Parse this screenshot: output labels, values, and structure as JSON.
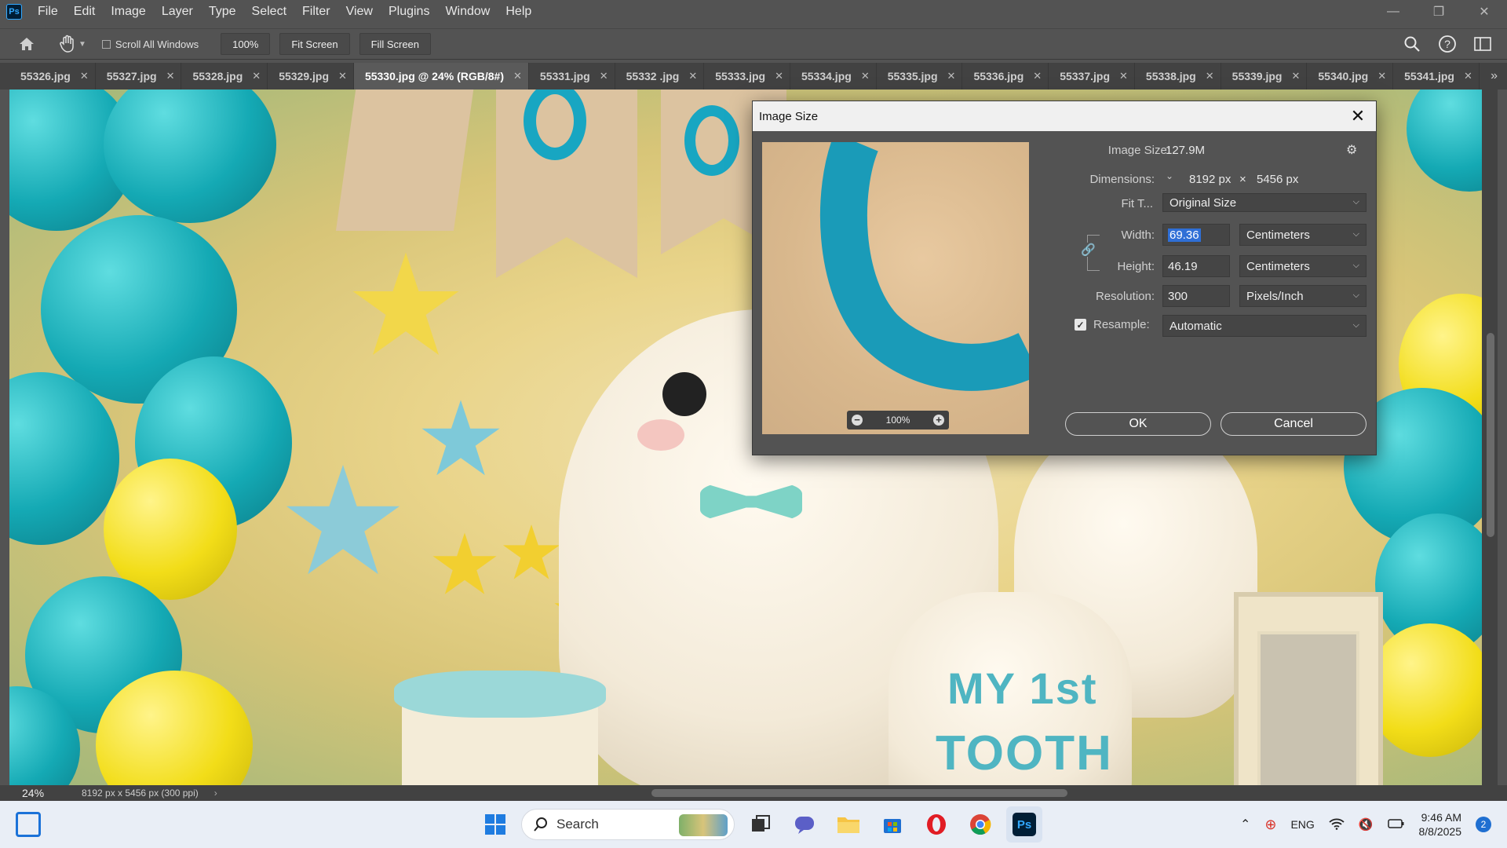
{
  "menu": [
    "File",
    "Edit",
    "Image",
    "Layer",
    "Type",
    "Select",
    "Filter",
    "View",
    "Plugins",
    "Window",
    "Help"
  ],
  "app_logo": "Ps",
  "options": {
    "scroll_all_windows": "Scroll All Windows",
    "zoom_value": "100%",
    "fit_screen": "Fit Screen",
    "fill_screen": "Fill Screen"
  },
  "tabs": [
    {
      "label": "55326.jpg",
      "active": false
    },
    {
      "label": "55327.jpg",
      "active": false
    },
    {
      "label": "55328.jpg",
      "active": false
    },
    {
      "label": "55329.jpg",
      "active": false
    },
    {
      "label": "55330.jpg @ 24% (RGB/8#)",
      "active": true
    },
    {
      "label": "55331.jpg",
      "active": false
    },
    {
      "label": "55332 .jpg",
      "active": false
    },
    {
      "label": "55333.jpg",
      "active": false
    },
    {
      "label": "55334.jpg",
      "active": false
    },
    {
      "label": "55335.jpg",
      "active": false
    },
    {
      "label": "55336.jpg",
      "active": false
    },
    {
      "label": "55337.jpg",
      "active": false
    },
    {
      "label": "55338.jpg",
      "active": false
    },
    {
      "label": "55339.jpg",
      "active": false
    },
    {
      "label": "55340.jpg",
      "active": false
    },
    {
      "label": "55341.jpg",
      "active": false
    }
  ],
  "canvas_text": {
    "line1": "MY 1st",
    "line2": "TOOTH"
  },
  "status": {
    "zoom": "24%",
    "doc_info": "8192 px x 5456 px (300 ppi)"
  },
  "dialog": {
    "title": "Image Size",
    "preview_zoom": "100%",
    "image_size_label": "Image Size:",
    "image_size_value": "127.9M",
    "dimensions_label": "Dimensions:",
    "dim_width": "8192 px",
    "dim_x": "×",
    "dim_height": "5456 px",
    "fit_label": "Fit T...",
    "fit_value": "Original Size",
    "width_label": "Width:",
    "width_value": "69.36",
    "width_unit": "Centimeters",
    "height_label": "Height:",
    "height_value": "46.19",
    "height_unit": "Centimeters",
    "resolution_label": "Resolution:",
    "resolution_value": "300",
    "resolution_unit": "Pixels/Inch",
    "resample_label": "Resample:",
    "resample_value": "Automatic",
    "ok": "OK",
    "cancel": "Cancel"
  },
  "taskbar": {
    "search": "Search",
    "lang": "ENG",
    "time": "9:46 AM",
    "date": "8/8/2025",
    "notif_count": "2"
  },
  "colors": {
    "accent": "#31a8ff",
    "selection": "#2f6fd6",
    "teal": "#14a9b4",
    "yellow": "#f2dd18"
  }
}
